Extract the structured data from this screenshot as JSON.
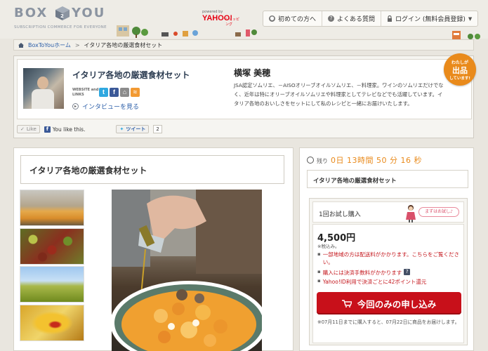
{
  "brand": {
    "logo_left": "BOX",
    "logo_right": "YOU",
    "tagline": "SUBSCRIPTION COMMERCE FOR EVERYONE",
    "partner_prefix": "powered by",
    "partner_name": "YAHOO!",
    "partner_suffix": "ショッピング",
    "accent_color": "#e98a1b"
  },
  "topnav": {
    "items": [
      {
        "icon": "person-icon",
        "label": "初めての方へ"
      },
      {
        "icon": "question-icon",
        "label": "よくある質問"
      },
      {
        "icon": "lock-icon",
        "label": "ログイン (無料会員登録)"
      }
    ]
  },
  "breadcrumb": {
    "home": "BoxToYouホーム",
    "separator": ">",
    "current": "イタリア各地の厳選食材セット"
  },
  "profile": {
    "set_title": "イタリア各地の厳選食材セット",
    "website_label": "WEBSITE and LINKS",
    "interview_link": "インタビューを見る",
    "name": "横塚 美穂",
    "bio": "JSA認定ソムリエ、－AISOオリーブオイルソムリエ、－料理家。ワインのソムリエだけでなく、近年は特にオリーブオイルソムリエや料理家としてテレビなどでも活躍しています。イタリア各地のおいしさをセットにして私のレシピと一緒にお届けいたします。",
    "badge": {
      "line1": "わたしが",
      "line2": "出品",
      "line3": "しています!"
    },
    "like_label": "Like",
    "you_like": "You like this.",
    "tweet_label": "ツイート",
    "tweet_count": "2"
  },
  "product": {
    "title": "イタリア各地の厳選食材セット"
  },
  "purchase": {
    "remaining_label": "残り",
    "time_left": "0日 13時間 50 分 16 秒",
    "title": "イタリア各地の厳選食材セット",
    "trial_label": "1回お試し購入",
    "trial_bubble": "まずはお試し♪",
    "price": "4,500円",
    "tax_note": "※税込み。",
    "note1_text": "一部地域の方は配送料がかかります。",
    "note1_link": "こちらをご覧ください。",
    "note2": "購入には決済手数料がかかります",
    "note3": "Yahoo!ID利用で決済ごとに42ポイント還元",
    "apply_label": "今回のみの申し込み",
    "deadline": "※07月11日までに購入すると、07月22日に商品をお届けします。"
  }
}
